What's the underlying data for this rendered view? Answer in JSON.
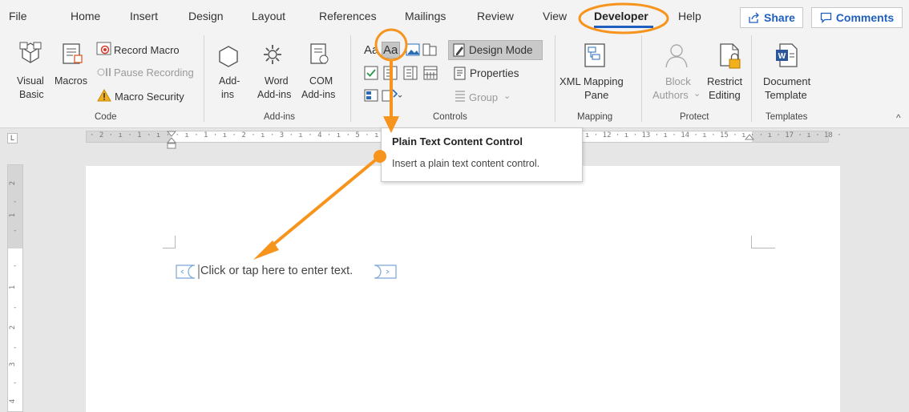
{
  "ribbon_tabs": {
    "file": "File",
    "home": "Home",
    "insert": "Insert",
    "design": "Design",
    "layout": "Layout",
    "references": "References",
    "mailings": "Mailings",
    "review": "Review",
    "view": "View",
    "developer": "Developer",
    "help": "Help"
  },
  "header_actions": {
    "share": "Share",
    "comments": "Comments"
  },
  "groups": {
    "code": {
      "label": "Code",
      "visual_basic": [
        "Visual",
        "Basic"
      ],
      "macros": "Macros",
      "record_macro": "Record Macro",
      "pause_recording": "Pause Recording",
      "macro_security": "Macro Security"
    },
    "addins": {
      "label": "Add-ins",
      "addins": [
        "Add-",
        "ins"
      ],
      "word_addins": [
        "Word",
        "Add-ins"
      ],
      "com_addins": [
        "COM",
        "Add-ins"
      ]
    },
    "controls": {
      "label": "Controls",
      "rich_text": "Aa",
      "plain_text": "Aa",
      "design_mode": "Design Mode",
      "properties": "Properties",
      "group": "Group"
    },
    "mapping": {
      "label": "Mapping",
      "xml_mapping": [
        "XML Mapping",
        "Pane"
      ]
    },
    "protect": {
      "label": "Protect",
      "block_authors": [
        "Block",
        "Authors"
      ],
      "restrict_editing": [
        "Restrict",
        "Editing"
      ]
    },
    "templates": {
      "label": "Templates",
      "document_template": [
        "Document",
        "Template"
      ]
    }
  },
  "ruler": {
    "horizontal": "· 2 · ı · 1 · ı ·  · ı · 1 · ı · 2 · ı · 3 · ı · 4 · ı · 5 · ı",
    "horizontal_right": "ı · 12 · ı · 13 · ı · 14 · ı · 15 · ı ·  · ı · 17 · ı · 18 ·"
  },
  "tooltip": {
    "title": "Plain Text Content Control",
    "description": "Insert a plain text content control."
  },
  "document": {
    "content_control_placeholder": "Click or tap here to enter text."
  },
  "colors": {
    "annotation": "#f7941d",
    "accent": "#1f5fbf",
    "ribbon_bg": "#f3f3f3"
  }
}
